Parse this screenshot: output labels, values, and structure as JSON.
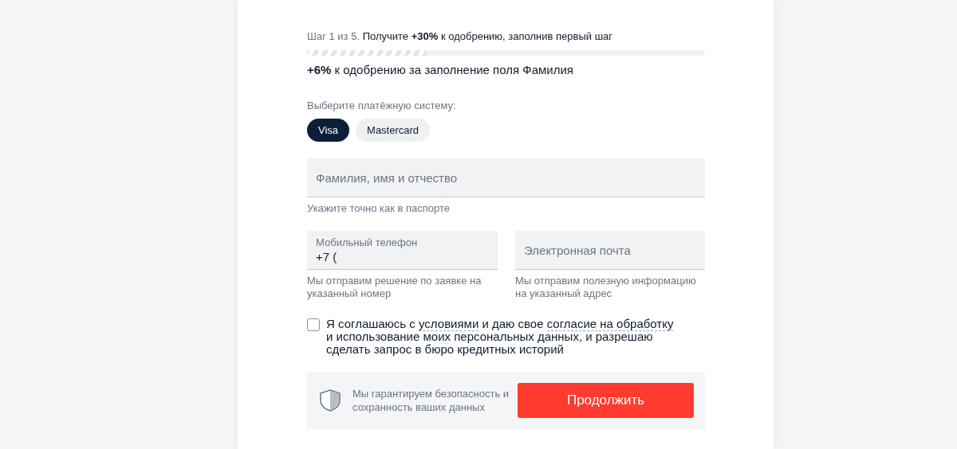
{
  "step": "Шаг 1 из 5.",
  "promo": "Получите **+30%** к одобрению, заполнив первый шаг",
  "progress": {
    "level": 0.3
  },
  "bonus": "**+6%** к одобрению за заполнение поля Фамилия",
  "payment": {
    "label": "Выберите платёжную систему:",
    "options": [
      {
        "label": "Visa",
        "selected": true
      },
      {
        "label": "Mastercard",
        "selected": false
      }
    ]
  },
  "name_field": {
    "placeholder": "Фамилия, имя и отчество",
    "hint": "Укажите точно как в паспорте"
  },
  "phone_field": {
    "label": "Мобильный телефон",
    "value": "+7 (",
    "hint": "Мы отправим решение по заявке на указанный номер"
  },
  "email_field": {
    "placeholder": "Электронная почта",
    "hint": "Мы отправим полезную информацию на указанный адрес"
  },
  "consent": {
    "checked": false,
    "segments": [
      {
        "kind": "text",
        "text": "Я соглашаюсь с "
      },
      {
        "kind": "link",
        "text": "условиями"
      },
      {
        "kind": "text",
        "text": " и даю свое "
      },
      {
        "kind": "link",
        "text": "согласие на обработку"
      },
      {
        "kind": "text",
        "text": " и использование моих персональных данных, и разрешаю сделать запрос в бюро кредитных историй"
      }
    ]
  },
  "security_note": "Мы гарантируем безопасность и сохранность ваших данных",
  "submit": "Продолжить"
}
